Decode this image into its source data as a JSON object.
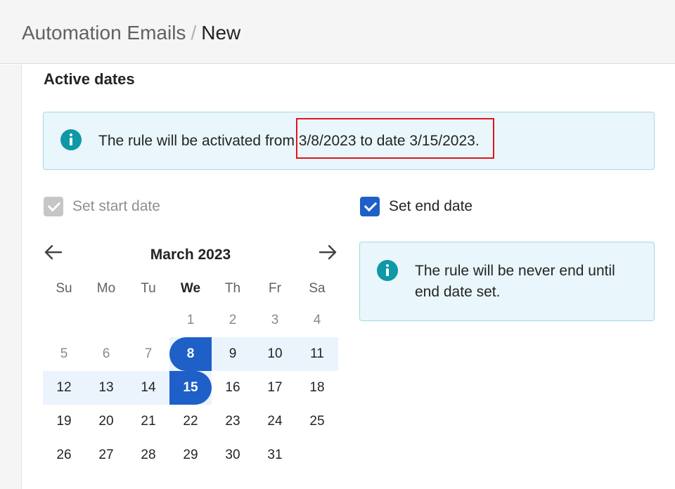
{
  "breadcrumb": {
    "root": "Automation Emails",
    "separator": "/",
    "current": "New"
  },
  "section_title": "Active dates",
  "activation_notice": {
    "text": "The rule will be activated from 3/8/2023 to date 3/15/2023.",
    "icon": "info-icon",
    "highlight_color": "#e0161e"
  },
  "start_date": {
    "label": "Set start date",
    "checked": true,
    "disabled": true
  },
  "end_date": {
    "label": "Set end date",
    "checked": true,
    "disabled": false
  },
  "calendar": {
    "month_label": "March 2023",
    "prev_icon": "arrow-left-icon",
    "next_icon": "arrow-right-icon",
    "weekdays": [
      "Su",
      "Mo",
      "Tu",
      "We",
      "Th",
      "Fr",
      "Sa"
    ],
    "today_weekday": "We",
    "weeks": [
      [
        "",
        "",
        "",
        "1",
        "2",
        "3",
        "4"
      ],
      [
        "5",
        "6",
        "7",
        "8",
        "9",
        "10",
        "11"
      ],
      [
        "12",
        "13",
        "14",
        "15",
        "16",
        "17",
        "18"
      ],
      [
        "19",
        "20",
        "21",
        "22",
        "23",
        "24",
        "25"
      ],
      [
        "26",
        "27",
        "28",
        "29",
        "30",
        "31",
        ""
      ]
    ],
    "selected_start": "8",
    "selected_end": "15"
  },
  "end_notice": {
    "text": "The rule will be never end until end date set.",
    "icon": "info-icon"
  },
  "colors": {
    "accent": "#1f5fc8",
    "info": "#0e98a8",
    "info_bg": "#e9f6fb",
    "range_bg": "#ebf3fc",
    "highlight": "#e0161e"
  }
}
